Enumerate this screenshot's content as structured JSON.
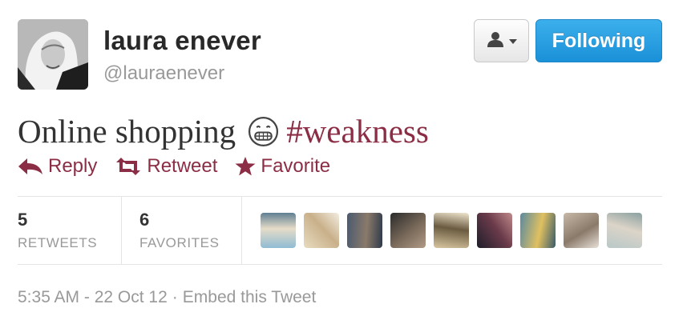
{
  "user": {
    "name": "laura enever",
    "handle": "@lauraenever"
  },
  "buttons": {
    "user_menu_icon": "person-icon",
    "follow_label": "Following",
    "follow_color": "#2aa0e3"
  },
  "tweet": {
    "text": "Online shopping",
    "emoji": "grinning-face-icon",
    "hashtag": "#weakness",
    "hashtag_color": "#8b2d45"
  },
  "actions": [
    {
      "label": "Reply",
      "icon": "reply-arrow-icon"
    },
    {
      "label": "Retweet",
      "icon": "retweet-icon"
    },
    {
      "label": "Favorite",
      "icon": "star-icon"
    }
  ],
  "stats": {
    "retweets": {
      "count": "5",
      "label": "RETWEETS"
    },
    "favorites": {
      "count": "6",
      "label": "FAVORITES"
    }
  },
  "favoriters": [
    {
      "palette": [
        "#8fbcd4",
        "#e6dcc8",
        "#5f7f93"
      ]
    },
    {
      "palette": [
        "#e8dcc0",
        "#c9b08a",
        "#f3ede2"
      ]
    },
    {
      "palette": [
        "#4a5a70",
        "#8a7a6a",
        "#2e3a4a"
      ]
    },
    {
      "palette": [
        "#2b2b2b",
        "#7a6a5a",
        "#b09a86"
      ]
    },
    {
      "palette": [
        "#d8c6a0",
        "#6a5a40",
        "#f0e6cf"
      ]
    },
    {
      "palette": [
        "#1e1e2a",
        "#6a3a4a",
        "#c08a8a"
      ]
    },
    {
      "palette": [
        "#5a8aa0",
        "#e0c060",
        "#3a5a6a"
      ]
    },
    {
      "palette": [
        "#c8b8a8",
        "#8a7a6a",
        "#e8e0d8"
      ]
    },
    {
      "palette": [
        "#b8c8c8",
        "#dcd4c8",
        "#8aa0a0"
      ]
    }
  ],
  "meta": {
    "time": "5:35 AM - 22 Oct 12",
    "separator": "·",
    "embed_label": "Embed this Tweet"
  }
}
